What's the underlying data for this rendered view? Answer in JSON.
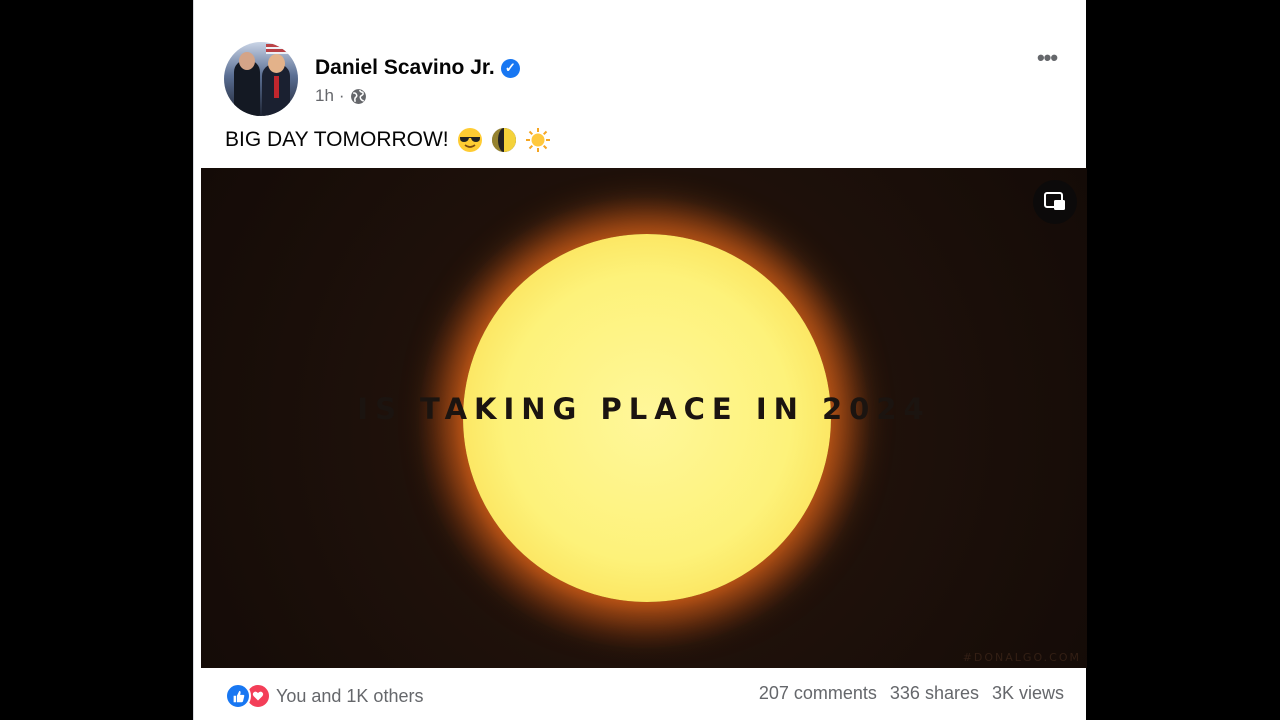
{
  "post": {
    "author": "Daniel Scavino Jr.",
    "verified_mark": "✓",
    "time": "1h",
    "separator": "·",
    "audience_icon": "globe-icon",
    "more_label": "•••",
    "text": "BIG DAY TOMORROW!",
    "emojis": [
      "smiling-face-with-sunglasses",
      "first-quarter-moon",
      "sun"
    ],
    "media": {
      "caption": "IS TAKING PLACE IN 2024",
      "watermark": "#DONALGO.COM",
      "pip_icon": "picture-in-picture-icon"
    }
  },
  "footer": {
    "reaction_icons": [
      "like-icon",
      "love-icon"
    ],
    "reactions_text": "You and 1K others",
    "comments": "207 comments",
    "shares": "336 shares",
    "views": "3K views"
  },
  "colors": {
    "brand_blue": "#1877f2",
    "love_red": "#f33e58",
    "secondary_text": "#65676b"
  }
}
